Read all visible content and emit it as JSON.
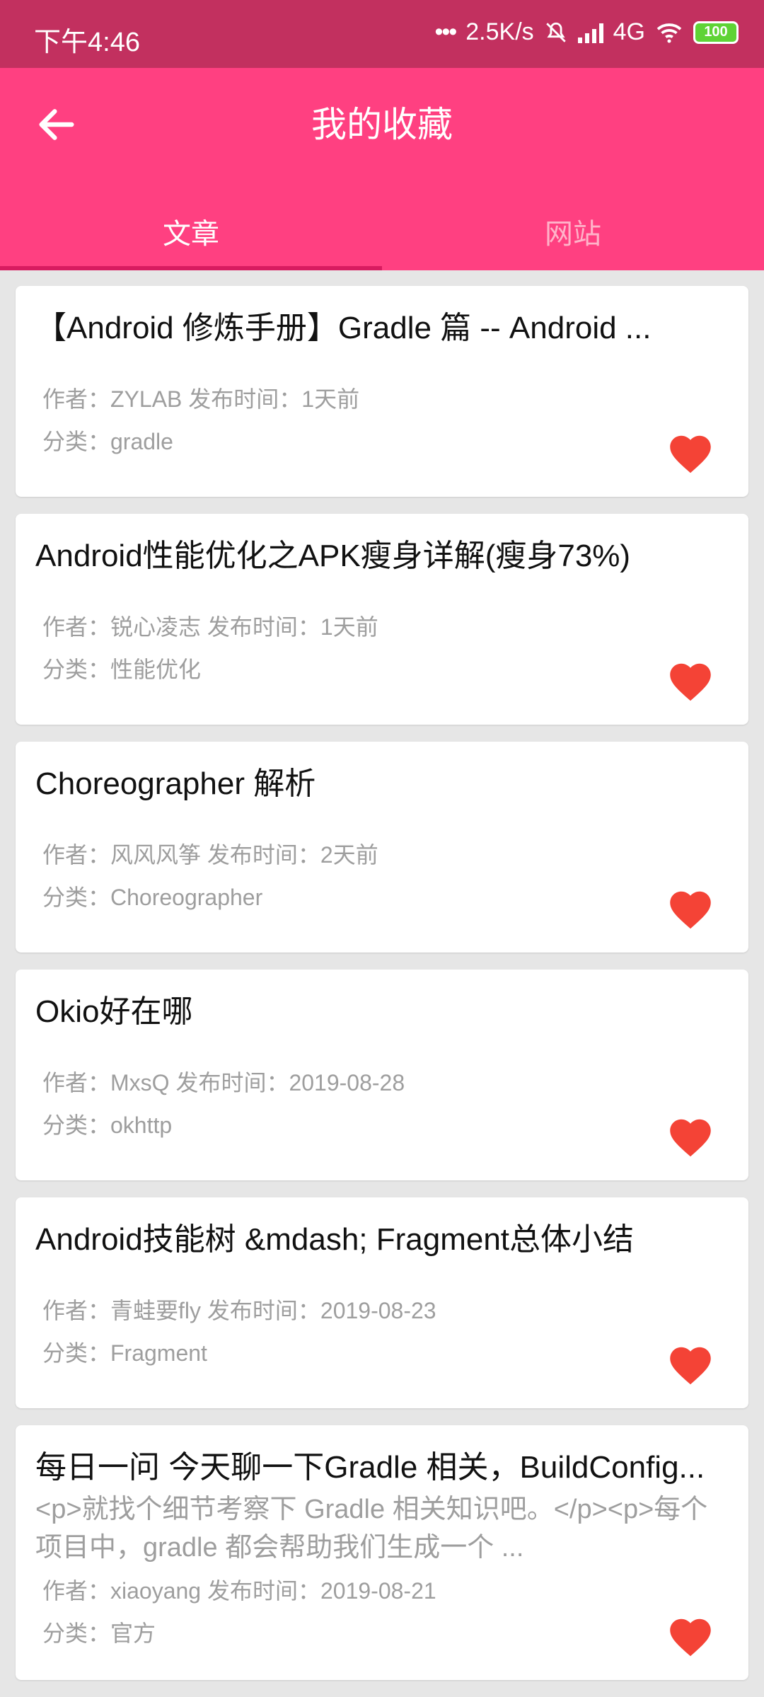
{
  "status": {
    "time": "下午4:46",
    "network_speed": "2.5K/s",
    "network_type": "4G",
    "battery": "100"
  },
  "header": {
    "title": "我的收藏",
    "back_icon": "arrow-left-icon"
  },
  "tabs": [
    {
      "label": "文章",
      "active": true
    },
    {
      "label": "网站",
      "active": false
    }
  ],
  "articles": [
    {
      "title": "【Android 修炼手册】Gradle 篇 -- Android ...",
      "author": "作者：ZYLAB  发布时间：1天前",
      "category": "分类：gradle",
      "favorited": true
    },
    {
      "title": "Android性能优化之APK瘦身详解(瘦身73%)",
      "author": "作者：锐心凌志  发布时间：1天前",
      "category": "分类：性能优化",
      "favorited": true
    },
    {
      "title": "Choreographer 解析",
      "author": "作者：风风风筝  发布时间：2天前",
      "category": "分类：Choreographer",
      "favorited": true
    },
    {
      "title": "Okio好在哪",
      "author": "作者：MxsQ  发布时间：2019-08-28",
      "category": "分类：okhttp",
      "favorited": true
    },
    {
      "title": "Android技能树 &mdash; Fragment总体小结",
      "author": "作者：青蛙要fly  发布时间：2019-08-23",
      "category": "分类：Fragment",
      "favorited": true
    },
    {
      "title": "每日一问 今天聊一下Gradle 相关，BuildConfig...",
      "snippet": "<p>就找个细节考察下 Gradle 相关知识吧。</p><p>每个项目中，gradle 都会帮助我们生成一个 ...",
      "author": "作者：xiaoyang  发布时间：2019-08-21",
      "category": "分类：官方",
      "favorited": true
    }
  ],
  "colors": {
    "accent": "#ff4081",
    "status_bar": "#c2305f",
    "heart": "#f44336"
  }
}
